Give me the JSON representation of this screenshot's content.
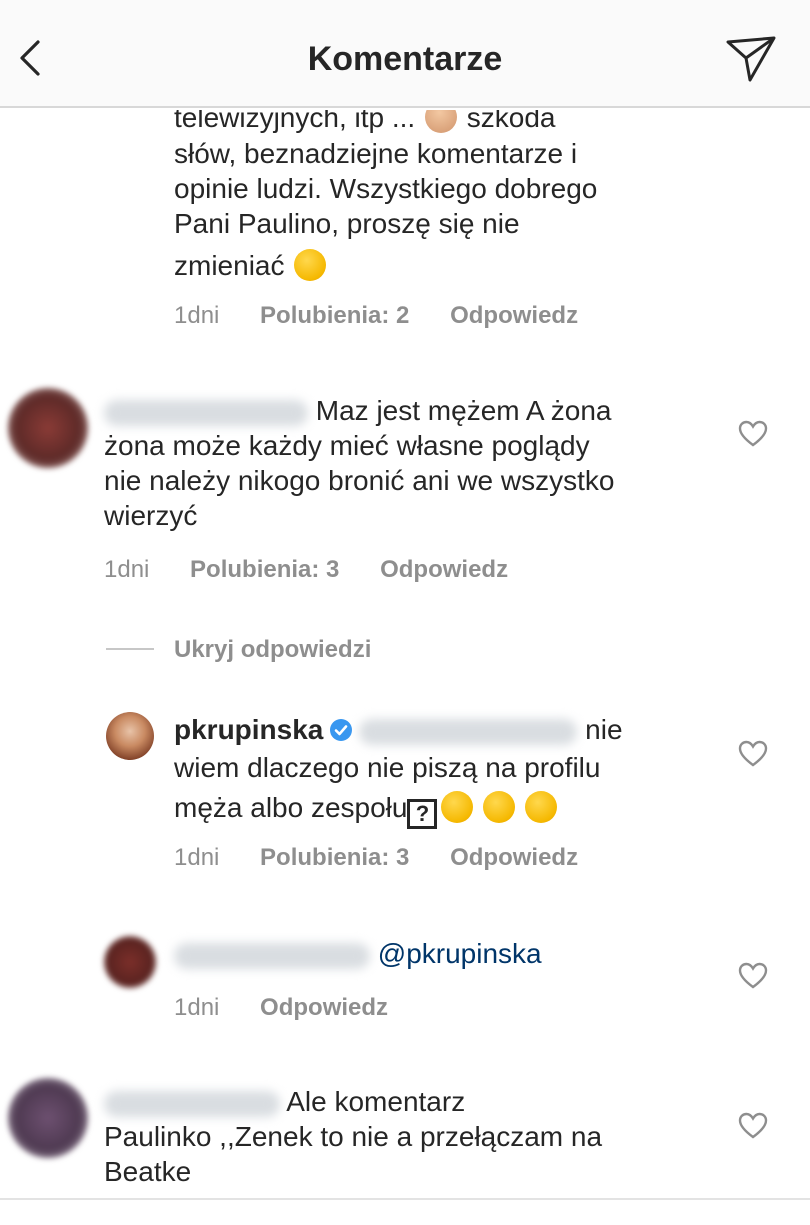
{
  "header": {
    "title": "Komentarze"
  },
  "comment0": {
    "line1a": "telewizyjnych, itp ...",
    "line1b": "szkoda",
    "line2": "słów, beznadziejne komentarze i",
    "line3": "opinie ludzi. Wszystkiego dobrego",
    "line4": "Pani Paulino, proszę się nie",
    "line5": "zmieniać",
    "time": "1dni",
    "likes": "Polubienia: 2",
    "reply": "Odpowiedz"
  },
  "comment1": {
    "line1": "Maz jest mężem A żona",
    "line2": "żona może każdy mieć własne poglądy",
    "line3": "nie należy nikogo bronić ani we wszystko",
    "line4": "wierzyć",
    "time": "1dni",
    "likes": "Polubienia: 3",
    "reply": "Odpowiedz"
  },
  "replies_toggle": {
    "label": "Ukryj odpowiedzi"
  },
  "reply1": {
    "username": "pkrupinska",
    "line1_end": "nie",
    "line2": "wiem dlaczego nie piszą na profilu",
    "line3": "męża albo zespołu",
    "time": "1dni",
    "likes": "Polubienia: 3",
    "reply": "Odpowiedz"
  },
  "reply2": {
    "mention": "@pkrupinska",
    "time": "1dni",
    "reply": "Odpowiedz"
  },
  "comment2": {
    "line1": "Ale komentarz",
    "line2": "Paulinko ,,Zenek to nie a przełączam na",
    "line3": "Beatke"
  },
  "colors": {
    "verified": "#3897f0",
    "mention": "#003569",
    "secondary": "#8e8e8e"
  },
  "icons": [
    "back-chevron-icon",
    "send-direct-icon",
    "heart-outline-icon",
    "verified-badge-icon"
  ]
}
